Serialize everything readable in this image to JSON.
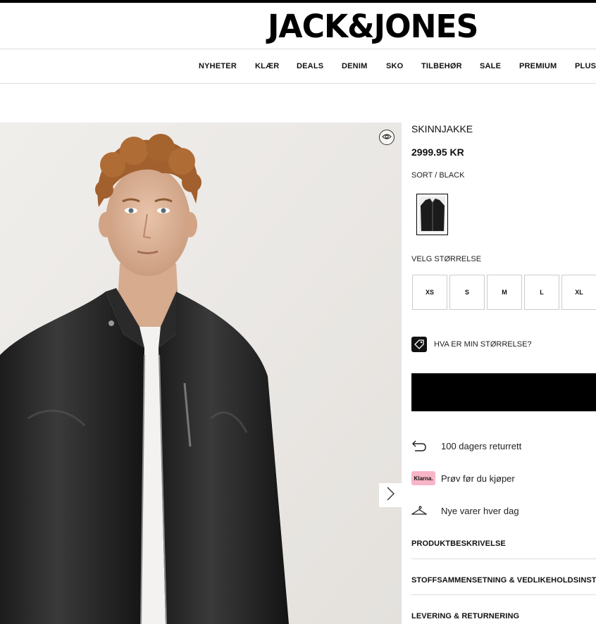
{
  "header": {
    "logo": "JACK&JONES"
  },
  "nav": {
    "items": [
      "NYHETER",
      "KLÆR",
      "DEALS",
      "DENIM",
      "SKO",
      "TILBEHØR",
      "SALE",
      "PREMIUM",
      "PLUS"
    ]
  },
  "product": {
    "title": "SKINNJAKKE",
    "price": "2999.95 KR",
    "color_name": "SORT / BLACK",
    "size_label": "VELG STØRRELSE",
    "sizes": [
      "XS",
      "S",
      "M",
      "L",
      "XL"
    ],
    "size_guide": "HVA ER MIN STØRRELSE?"
  },
  "perks": [
    "100 dagers returrett",
    "Prøv før du kjøper",
    "Nye varer hver dag"
  ],
  "klarna_badge": "Klarna.",
  "accordions": [
    "PRODUKTBESKRIVELSE",
    "STOFFSAMMENSETNING & VEDLIKEHOLDSINSTRUKSJONER",
    "LEVERING & RETURNERING"
  ],
  "colors": {
    "accent": "#000000",
    "klarna_pink": "#f8b5c8",
    "border": "#dddddd"
  },
  "icons": [
    "eye-icon",
    "chevron-right-icon",
    "tag-icon",
    "return-arrow-icon",
    "hanger-icon"
  ]
}
